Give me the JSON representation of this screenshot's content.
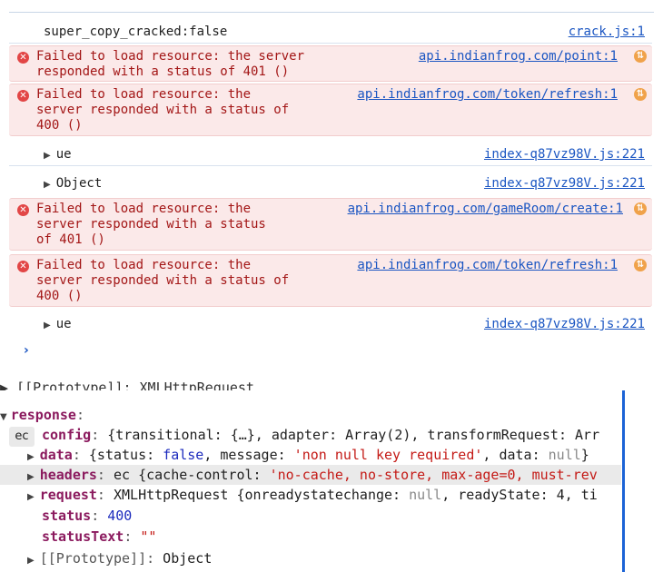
{
  "console": {
    "rows": [
      {
        "type": "plain",
        "message": "super_copy_cracked:false",
        "source": "crack.js:1"
      },
      {
        "type": "error",
        "message": "Failed to load resource: the server\nresponded with a status of 401 ()",
        "source": "api.indianfrog.com/point:1"
      },
      {
        "type": "error",
        "message": "Failed to load resource: the\nserver responded with a status of\n400 ()",
        "source": "api.indianfrog.com/token/refresh:1"
      },
      {
        "type": "plain",
        "message": "ue",
        "source": "index-q87vz98V.js:221",
        "expandable": true
      },
      {
        "type": "plain",
        "message": "Object",
        "source": "index-q87vz98V.js:221",
        "expandable": true
      },
      {
        "type": "error",
        "message": "Failed to load resource: the\nserver responded with a status\nof 401 ()",
        "source": "api.indianfrog.com/gameRoom/create:1"
      },
      {
        "type": "error",
        "message": "Failed to load resource: the\nserver responded with a status of\n400 ()",
        "source": "api.indianfrog.com/token/refresh:1"
      },
      {
        "type": "plain",
        "message": "ue",
        "source": "index-q87vz98V.js:221",
        "expandable": true
      }
    ],
    "prompt_symbol": "›"
  },
  "icons": {
    "error": "error-circle-x-icon",
    "network": "network-request-icon",
    "expand": "expand-triangle-icon"
  },
  "object_view": {
    "cut_line": "▶ [[Prototype]]: XMLHttpRequest",
    "response_key": "response",
    "config": {
      "key": "config",
      "value": "{transitional: {…}, adapter: Array(2), transformRequest: Arr"
    },
    "data": {
      "key": "data",
      "prefix": "{status: ",
      "status_val": "false",
      "mid": ", message: ",
      "message_val": "'non null key required'",
      "mid2": ", data: ",
      "data_val": "null",
      "suffix": "}"
    },
    "headers": {
      "key": "headers",
      "prefix": "ec {cache-control: ",
      "value": "'no-cache, no-store, max-age=0, must-rev"
    },
    "request": {
      "key": "request",
      "prefix": "XMLHttpRequest {onreadystatechange: ",
      "null_val": "null",
      "suffix": ", readyState: 4, ti"
    },
    "status": {
      "key": "status",
      "value": "400"
    },
    "statusText": {
      "key": "statusText",
      "value": "\"\""
    },
    "prototype": {
      "key": "[[Prototype]]",
      "value": "Object"
    },
    "badge": "ec"
  },
  "colors": {
    "error_bg": "#fbe9e9",
    "error_text": "#a31616",
    "link": "#1a55c2",
    "key": "#8b1a5e",
    "selection": "#1b63d6"
  }
}
